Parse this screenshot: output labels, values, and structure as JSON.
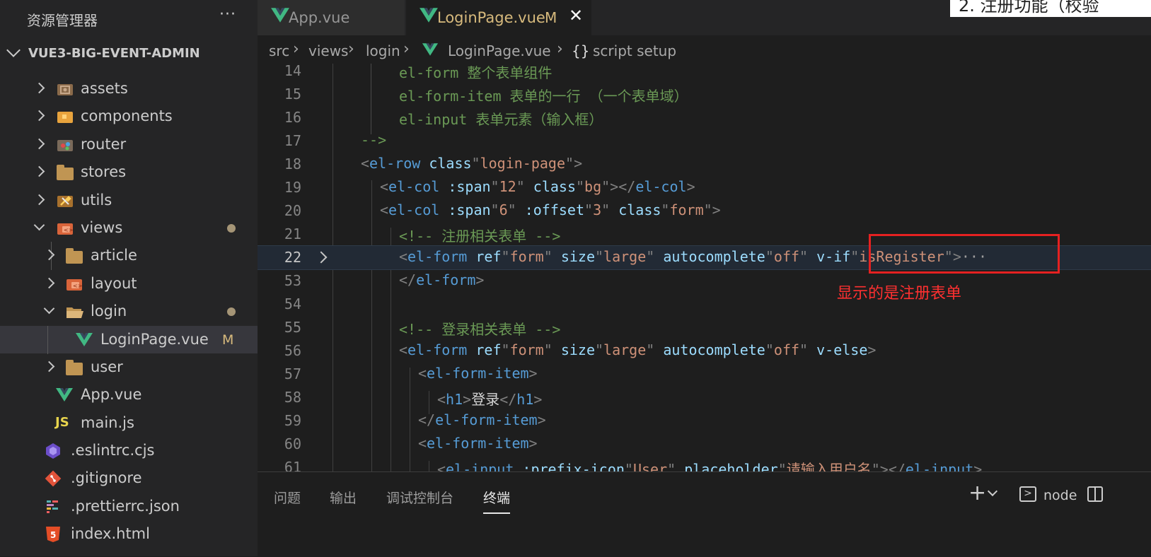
{
  "sidebar": {
    "title": "资源管理器",
    "more": "···",
    "project": "VUE3-BIG-EVENT-ADMIN",
    "items": [
      {
        "label": "assets",
        "kind": "folder-closed",
        "icon": "assets-folder-icon"
      },
      {
        "label": "components",
        "kind": "folder-closed",
        "icon": "components-folder-icon"
      },
      {
        "label": "router",
        "kind": "folder-closed",
        "icon": "router-folder-icon"
      },
      {
        "label": "stores",
        "kind": "folder-closed",
        "icon": "folder-icon"
      },
      {
        "label": "utils",
        "kind": "folder-closed",
        "icon": "utils-folder-icon"
      },
      {
        "label": "views",
        "kind": "folder-open",
        "icon": "views-folder-icon",
        "modified": true
      },
      {
        "label": "article",
        "kind": "folder-closed",
        "icon": "folder-icon"
      },
      {
        "label": "layout",
        "kind": "folder-closed",
        "icon": "vue-folder-icon"
      },
      {
        "label": "login",
        "kind": "folder-open",
        "icon": "folder-open-icon",
        "modified": true
      },
      {
        "label": "LoginPage.vue",
        "kind": "file",
        "icon": "vue-file-icon",
        "badge": "M",
        "selected": true
      },
      {
        "label": "user",
        "kind": "folder-closed",
        "icon": "folder-icon"
      },
      {
        "label": "App.vue",
        "kind": "file",
        "icon": "vue-file-icon"
      },
      {
        "label": "main.js",
        "kind": "file",
        "icon": "js-file-icon",
        "icon_text": "JS"
      },
      {
        "label": ".eslintrc.cjs",
        "kind": "file",
        "icon": "eslint-file-icon"
      },
      {
        "label": ".gitignore",
        "kind": "file",
        "icon": "git-file-icon"
      },
      {
        "label": ".prettierrc.json",
        "kind": "file",
        "icon": "prettier-file-icon"
      },
      {
        "label": "index.html",
        "kind": "file",
        "icon": "html-file-icon",
        "icon_text": "5"
      }
    ]
  },
  "tabs": [
    {
      "label": "App.vue",
      "active": false
    },
    {
      "label": "LoginPage.vue",
      "badge": "M",
      "close": "✕",
      "active": true
    }
  ],
  "overlay_text": "2.    注册功能（校验",
  "breadcrumb": {
    "parts": [
      "src",
      "views",
      "login",
      "LoginPage.vue",
      "script setup"
    ],
    "sep": "›",
    "braces": "{}"
  },
  "editor": {
    "lines": [
      {
        "n": "14",
        "text": "el-form 整个表单组件"
      },
      {
        "n": "15",
        "text": "el-form-item 表单的一行 （一个表单域）"
      },
      {
        "n": "16",
        "text": "el-input 表单元素（输入框）"
      },
      {
        "n": "17",
        "text": "-->"
      },
      {
        "n": "18",
        "text": "<el-row class=\"login-page\">"
      },
      {
        "n": "19",
        "text": "<el-col :span=\"12\" class=\"bg\"></el-col>"
      },
      {
        "n": "20",
        "text": "<el-col :span=\"6\" :offset=\"3\" class=\"form\">"
      },
      {
        "n": "21",
        "text": "<!-- 注册相关表单 -->"
      },
      {
        "n": "22",
        "text": "<el-form ref=\"form\" size=\"large\" autocomplete=\"off\" v-if=\"isRegister\">···"
      },
      {
        "n": "53",
        "text": "</el-form>"
      },
      {
        "n": "54",
        "text": ""
      },
      {
        "n": "55",
        "text": "<!-- 登录相关表单 -->"
      },
      {
        "n": "56",
        "text": "<el-form ref=\"form\" size=\"large\" autocomplete=\"off\" v-else>"
      },
      {
        "n": "57",
        "text": "<el-form-item>"
      },
      {
        "n": "58",
        "text": "<h1>登录</h1>"
      },
      {
        "n": "59",
        "text": "</el-form-item>"
      },
      {
        "n": "60",
        "text": "<el-form-item>"
      },
      {
        "n": "61",
        "text": "<el-input :prefix-icon=\"User\" placeholder=\"请输入用户名\"></el-input>"
      }
    ],
    "annotation": "显示的是注册表单"
  },
  "panel": {
    "tabs": [
      "问题",
      "输出",
      "调试控制台",
      "终端"
    ],
    "active_tab": "终端",
    "add": "+",
    "terminal_name": "node"
  },
  "colors": {
    "comment": "#6a9955",
    "tag": "#569cd6",
    "attr": "#9cdcfe",
    "string": "#ce9178",
    "annotation_red": "#e52121",
    "modified": "#d7ba7d",
    "vue_green": "#41b883"
  }
}
